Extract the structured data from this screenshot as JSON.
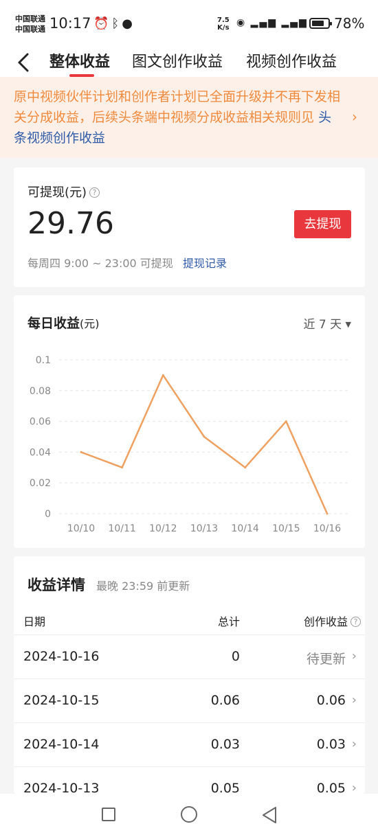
{
  "status_bar": {
    "carrier1": "中国联通",
    "carrier2": "中国联通",
    "time": "10:17",
    "net_speed_value": "7.5",
    "net_speed_unit": "K/s",
    "battery": "78%",
    "battery_level": 0.78
  },
  "nav": {
    "tabs": [
      {
        "label": "整体收益",
        "active": true
      },
      {
        "label": "图文创作收益",
        "active": false
      },
      {
        "label": "视频创作收益",
        "active": false
      }
    ]
  },
  "notice": {
    "text": "原中视频伙伴计划和创作者计划已全面升级并不再下发相关分成收益，后续头条端中视频分成收益相关规则见",
    "link": "头条视频创作收益"
  },
  "balance": {
    "label": "可提现(元)",
    "amount": "29.76",
    "button": "去提现",
    "note": "每周四 9:00 ~ 23:00 可提现",
    "link": "提现记录"
  },
  "daily_chart": {
    "title": "每日收益",
    "unit": "(元)",
    "range": "近 7 天"
  },
  "chart_data": {
    "type": "line",
    "title": "每日收益(元)",
    "x": [
      "10/10",
      "10/11",
      "10/12",
      "10/13",
      "10/14",
      "10/15",
      "10/16"
    ],
    "y": [
      0.04,
      0.03,
      0.09,
      0.05,
      0.03,
      0.06,
      0
    ],
    "yticks": [
      "0",
      "0.02",
      "0.04",
      "0.06",
      "0.08",
      "0.1"
    ],
    "ylim": [
      0,
      0.1
    ],
    "grid": true,
    "color": "#f0a060"
  },
  "detail": {
    "title": "收益详情",
    "subtitle": "最晚 23:59 前更新",
    "headers": {
      "date": "日期",
      "total": "总计",
      "earn": "创作收益"
    },
    "rows": [
      {
        "date": "2024-10-16",
        "total": "0",
        "earn": "待更新"
      },
      {
        "date": "2024-10-15",
        "total": "0.06",
        "earn": "0.06"
      },
      {
        "date": "2024-10-14",
        "total": "0.03",
        "earn": "0.03"
      },
      {
        "date": "2024-10-13",
        "total": "0.05",
        "earn": "0.05"
      }
    ]
  }
}
